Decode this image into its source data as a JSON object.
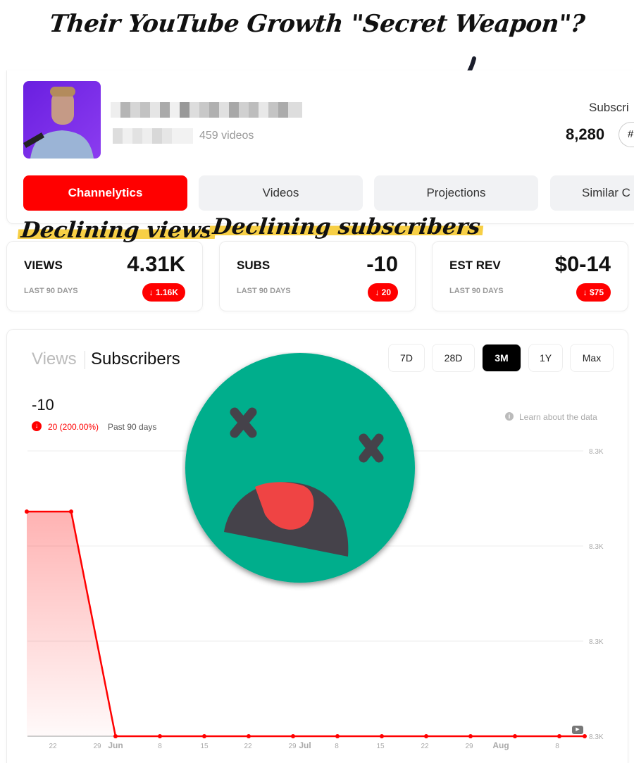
{
  "headline": "Their YouTube Growth \"Secret Weapon\"?",
  "channel": {
    "video_count": "459 videos",
    "subscribers_label": "Subscri",
    "subscribers": "8,280",
    "rank_label": "#"
  },
  "tabs": [
    {
      "label": "Channelytics",
      "active": true
    },
    {
      "label": "Videos"
    },
    {
      "label": "Projections"
    },
    {
      "label": "Similar C"
    }
  ],
  "annotations": {
    "views": "Declining views",
    "subs": "Declining subscribers"
  },
  "stats": [
    {
      "title": "VIEWS",
      "value": "4.31K",
      "period": "LAST 90 DAYS",
      "change": "↓ 1.16K"
    },
    {
      "title": "SUBS",
      "value": "-10",
      "period": "LAST 90 DAYS",
      "change": "↓ 20"
    },
    {
      "title": "EST REV",
      "value": "$0-14",
      "period": "LAST 90 DAYS",
      "change": "↓ $75"
    }
  ],
  "chart_panel": {
    "toggle": {
      "views": "Views",
      "subscribers": "Subscribers",
      "active": "Subscribers"
    },
    "ranges": [
      {
        "label": "7D"
      },
      {
        "label": "28D"
      },
      {
        "label": "3M",
        "active": true
      },
      {
        "label": "1Y"
      },
      {
        "label": "Max"
      }
    ],
    "total": "-10",
    "change": "20 (200.00%)",
    "period": "Past 90 days",
    "learn": "Learn about the data"
  },
  "colors": {
    "accent": "#ff0000",
    "emoji_face": "#00ae8c"
  },
  "chart_data": {
    "type": "area",
    "ylim": [
      8280,
      8292.7
    ],
    "y_ticks": [
      "8.3K",
      "8.3K",
      "8.3K",
      "8.3K"
    ],
    "x_ticks": [
      "22",
      "29",
      "Jun",
      "8",
      "15",
      "22",
      "29",
      "Jul",
      "8",
      "15",
      "22",
      "29",
      "Aug",
      "8"
    ],
    "series": [
      {
        "x": [
          "May 18",
          "May 25",
          "Jun 1",
          "Jun 8",
          "Jun 15",
          "Jun 22",
          "Jun 29",
          "Jul 6",
          "Jul 13",
          "Jul 20",
          "Jul 27",
          "Aug 3",
          "Aug 10",
          "Aug 14"
        ],
        "values": [
          8290,
          8290,
          8280,
          8280,
          8280,
          8280,
          8280,
          8280,
          8280,
          8280,
          8280,
          8280,
          8280,
          8280
        ]
      }
    ],
    "grid": true
  }
}
